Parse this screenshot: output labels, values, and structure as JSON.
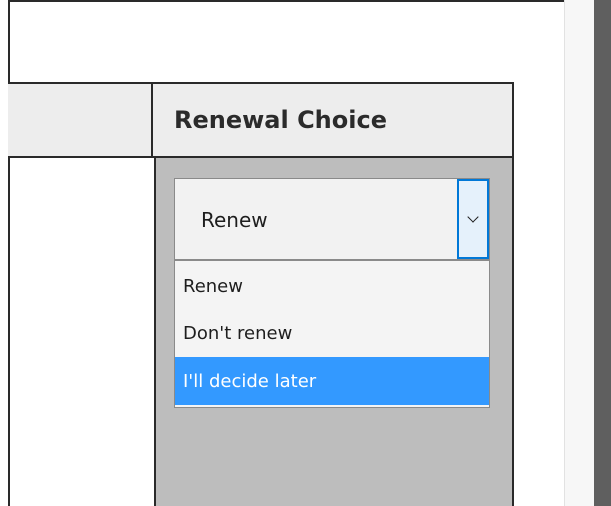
{
  "table": {
    "header": {
      "left_label": "",
      "right_label": "Renewal Choice"
    },
    "renewal_select": {
      "selected_value": "Renew",
      "options": [
        {
          "label": "Renew",
          "highlighted": false
        },
        {
          "label": "Don't renew",
          "highlighted": false
        },
        {
          "label": "I'll decide later",
          "highlighted": true
        }
      ]
    }
  },
  "colors": {
    "highlight": "#3399ff",
    "dropdown_button_border": "#0078d7",
    "cell_background": "#bdbdbd",
    "header_background": "#ededed"
  },
  "icons": {
    "dropdown": "chevron-down-icon"
  }
}
